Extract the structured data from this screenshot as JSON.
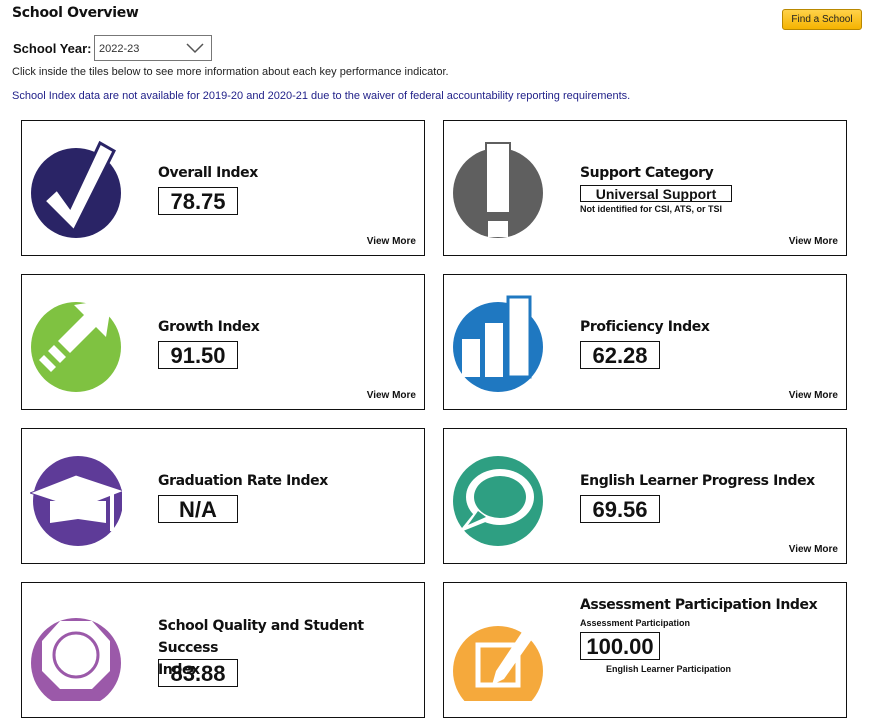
{
  "header": {
    "title": "School Overview",
    "find_school_label": "Find a School",
    "school_year_label": "School Year:",
    "school_year_value": "2022-23",
    "hint": "Click inside the tiles below to see more information about each key performance indicator.",
    "notice": "School Index data are not available for 2019-20 and 2020-21 due to the waiver of federal accountability reporting requirements."
  },
  "tiles": {
    "overall": {
      "name": "Overall Index",
      "value": "78.75",
      "more": "View More",
      "color": "#2a2466"
    },
    "support": {
      "name": "Support Category",
      "value": "Universal Support",
      "note": "Not identified for CSI, ATS, or TSI",
      "more": "View More",
      "color": "#5f5f5f"
    },
    "growth": {
      "name": "Growth Index",
      "value": "91.50",
      "more": "View More",
      "color": "#7fc241"
    },
    "proficiency": {
      "name": "Proficiency Index",
      "value": "62.28",
      "more": "View More",
      "color": "#1f78c1"
    },
    "graduation": {
      "name": "Graduation Rate Index",
      "value": "N/A",
      "color": "#5e3b98"
    },
    "elp": {
      "name": "English Learner Progress Index",
      "value": "69.56",
      "more": "View More",
      "color": "#2e9f82"
    },
    "sqss": {
      "name_line1": "School Quality and Student Success",
      "name_line2": "Index",
      "value": "83.88",
      "color": "#9b59a9"
    },
    "participation": {
      "name": "Assessment Participation Index",
      "sub1": "Assessment Participation",
      "value": "100.00",
      "sub2": "English Learner Participation",
      "color": "#f5a93c"
    }
  }
}
